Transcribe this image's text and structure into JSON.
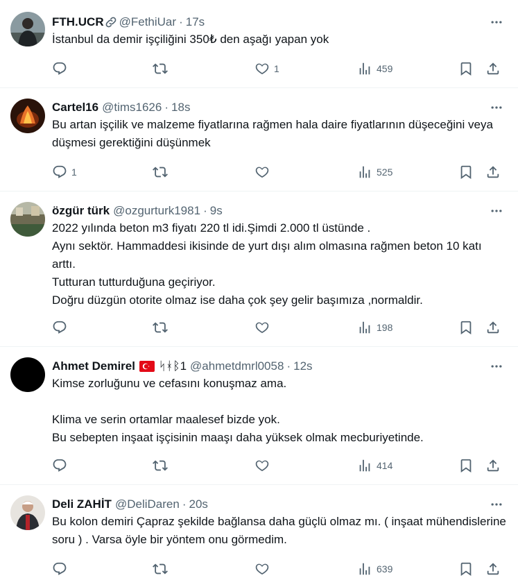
{
  "tweets": [
    {
      "display_name": "FTH.UCR",
      "handle": "@FethiUar",
      "separator": "·",
      "time": "17s",
      "text": "İstanbul da demir işçiliğini 350₺ den aşağı yapan yok",
      "replies": "",
      "likes": "1",
      "views": "459",
      "avatar": "avatar-photo-man-dark"
    },
    {
      "display_name": "Cartel16",
      "handle": "@tims1626",
      "separator": "·",
      "time": "18s",
      "text": "Bu artan işçilik ve malzeme fiyatlarına rağmen hala daire fiyatlarının düşeceğini veya düşmesi gerektiğini düşünmek",
      "replies": "1",
      "likes": "",
      "views": "525",
      "avatar": "avatar-photo-fire"
    },
    {
      "display_name": "özgür türk",
      "handle": "@ozgurturk1981",
      "separator": "·",
      "time": "9s",
      "text": "2022 yılında beton m3 fiyatı 220 tl idi.Şimdi 2.000 tl üstünde .\nAynı sektör. Hammaddesi ikisinde de yurt dışı alım olmasına rağmen beton 10 katı arttı.\nTutturan tutturduğuna geçiriyor.\nDoğru düzgün otorite olmaz ise daha çok şey gelir başımıza ,normaldir.",
      "replies": "",
      "likes": "",
      "views": "198",
      "avatar": "avatar-photo-room"
    },
    {
      "display_name": "Ahmet Demirel",
      "name_suffix": "ᛋᚼᛒ1",
      "handle": "@ahmetdmrl0058",
      "separator": "·",
      "time": "12s",
      "text": "Kimse zorluğunu ve cefasını konuşmaz ama.\n\nKlima ve serin ortamlar maalesef bizde yok.\nBu sebepten inşaat işçisinin maaşı daha yüksek olmak mecburiyetinde.",
      "replies": "",
      "likes": "",
      "views": "414",
      "avatar": "avatar-black"
    },
    {
      "display_name": "Deli ZAHİT",
      "handle": "@DeliDaren",
      "separator": "·",
      "time": "20s",
      "text": "Bu kolon demiri Çapraz şekilde bağlansa daha güçlü olmaz mı. ( inşaat mühendislerine soru ) . Varsa öyle bir yöntem onu görmedim.",
      "replies": "",
      "likes": "",
      "views": "639",
      "avatar": "avatar-photo-man-red"
    }
  ],
  "icons": {
    "more": "more-dots-icon",
    "reply": "reply-icon",
    "retweet": "retweet-icon",
    "like": "heart-icon",
    "views": "views-chart-icon",
    "bookmark": "bookmark-icon",
    "share": "share-icon",
    "link": "link-icon",
    "flag": "turkey-flag-icon"
  },
  "colors": {
    "text": "#0f1419",
    "secondary": "#536471",
    "divider": "#eff3f4",
    "flag_red": "#e30a17"
  }
}
